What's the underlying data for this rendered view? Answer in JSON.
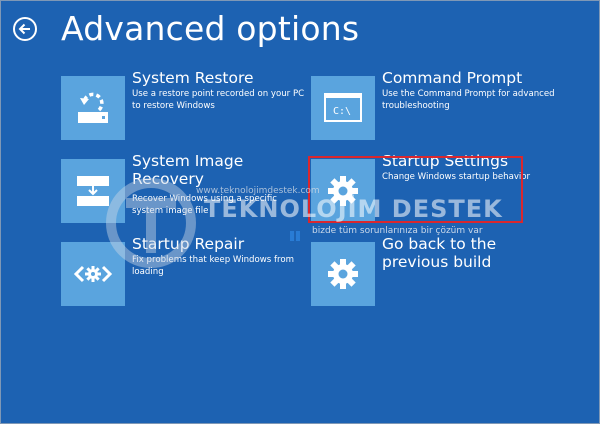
{
  "page": {
    "title": "Advanced options",
    "back_icon": "back-arrow-icon"
  },
  "options": [
    {
      "title": "System Restore",
      "desc": "Use a restore point recorded on your PC to restore Windows",
      "icon": "system-restore-icon"
    },
    {
      "title": "Command Prompt",
      "desc": "Use the Command Prompt for advanced troubleshooting",
      "icon": "command-prompt-icon",
      "icon_text": "C:\\"
    },
    {
      "title": "System Image Recovery",
      "desc": "Recover Windows using a specific system image file",
      "icon": "system-image-icon"
    },
    {
      "title": "Startup Settings",
      "desc": "Change Windows startup behavior",
      "icon": "gear-icon",
      "highlighted": true
    },
    {
      "title": "Startup Repair",
      "desc": "Fix problems that keep Windows from loading",
      "icon": "startup-repair-icon"
    },
    {
      "title": "Go back to the previous build",
      "desc": "",
      "icon": "gear-icon"
    }
  ],
  "watermark": {
    "url": "www.teknolojimdestek.com",
    "name": "TEKNOLOJİM DESTEK",
    "slogan": "bizde tüm sorunlarınıza bir çözüm var"
  },
  "colors": {
    "background": "#1d62b2",
    "tile": "#5aa4de",
    "highlight": "#d9272e"
  }
}
